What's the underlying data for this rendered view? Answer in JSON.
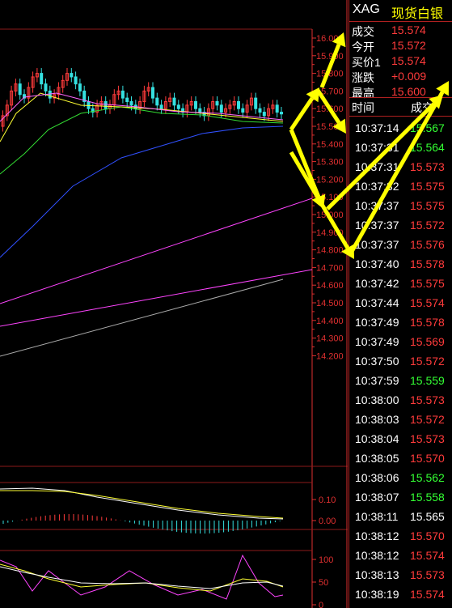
{
  "quote": {
    "symbol": "XAG",
    "name": "现货白银",
    "rows": [
      {
        "label": "成交",
        "value": "15.574"
      },
      {
        "label": "今开",
        "value": "15.572"
      },
      {
        "label": "买价1",
        "value": "15.574"
      },
      {
        "label": "涨跌",
        "value": "+0.009"
      },
      {
        "label": "最高",
        "value": "15.600"
      }
    ]
  },
  "ticks_header": {
    "time": "时间",
    "price": "成交"
  },
  "ticks": [
    {
      "time": "10:37:14",
      "price": "15.567",
      "dir": "down"
    },
    {
      "time": "10:37:31",
      "price": "15.564",
      "dir": "down"
    },
    {
      "time": "10:37:31",
      "price": "15.573",
      "dir": "up"
    },
    {
      "time": "10:37:32",
      "price": "15.575",
      "dir": "up"
    },
    {
      "time": "10:37:37",
      "price": "15.575",
      "dir": "up"
    },
    {
      "time": "10:37:37",
      "price": "15.572",
      "dir": "up"
    },
    {
      "time": "10:37:37",
      "price": "15.576",
      "dir": "up"
    },
    {
      "time": "10:37:40",
      "price": "15.578",
      "dir": "up"
    },
    {
      "time": "10:37:42",
      "price": "15.575",
      "dir": "up"
    },
    {
      "time": "10:37:44",
      "price": "15.574",
      "dir": "up"
    },
    {
      "time": "10:37:49",
      "price": "15.578",
      "dir": "up"
    },
    {
      "time": "10:37:49",
      "price": "15.569",
      "dir": "up"
    },
    {
      "time": "10:37:50",
      "price": "15.572",
      "dir": "up"
    },
    {
      "time": "10:37:59",
      "price": "15.559",
      "dir": "down"
    },
    {
      "time": "10:38:00",
      "price": "15.573",
      "dir": "up"
    },
    {
      "time": "10:38:03",
      "price": "15.572",
      "dir": "up"
    },
    {
      "time": "10:38:04",
      "price": "15.573",
      "dir": "up"
    },
    {
      "time": "10:38:05",
      "price": "15.570",
      "dir": "up"
    },
    {
      "time": "10:38:06",
      "price": "15.562",
      "dir": "down"
    },
    {
      "time": "10:38:07",
      "price": "15.558",
      "dir": "down"
    },
    {
      "time": "10:38:11",
      "price": "15.565",
      "dir": "flat"
    },
    {
      "time": "10:38:12",
      "price": "15.570",
      "dir": "up"
    },
    {
      "time": "10:38:12",
      "price": "15.574",
      "dir": "up"
    },
    {
      "time": "10:38:13",
      "price": "15.573",
      "dir": "up"
    },
    {
      "time": "10:38:19",
      "price": "15.574",
      "dir": "up"
    }
  ],
  "colors": {
    "up": "#ff3b3b",
    "down": "#33ff33",
    "flat": "#ffffff",
    "axis": "#e03030",
    "arrow": "#ffff00"
  },
  "price_axis": [
    "16.000",
    "15.900",
    "15.800",
    "15.700",
    "15.600",
    "15.500",
    "15.400",
    "15.300",
    "15.200",
    "15.100",
    "15.000",
    "14.900",
    "14.800",
    "14.700",
    "14.600",
    "14.500",
    "14.400",
    "14.300",
    "14.200"
  ],
  "macd_axis": [
    "0.10",
    "0.00"
  ],
  "kdj_axis": [
    "100",
    "50",
    "0"
  ]
}
